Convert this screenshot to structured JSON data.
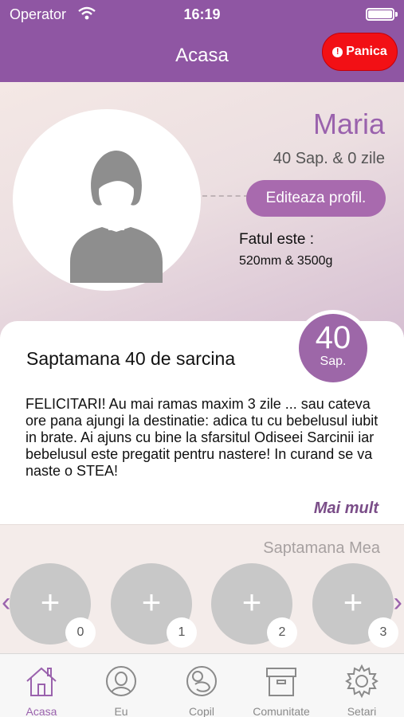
{
  "status_bar": {
    "carrier": "Operator",
    "time": "16:19"
  },
  "nav": {
    "title": "Acasa",
    "panic_label": "Panica",
    "panic_icon": "!"
  },
  "profile": {
    "name": "Maria",
    "weeks_text": "40 Sap. & 0 zile",
    "edit_label": "Editeaza profil.",
    "fetus_label": "Fatul este  :",
    "fetus_value": "520mm & 3500g"
  },
  "card": {
    "title": "Saptamana 40 de sarcina",
    "badge_number": "40",
    "badge_unit": "Sap.",
    "text": "FELICITARI! Au mai ramas maxim 3 zile ... sau cateva ore pana ajungi la destinatie: adica tu cu bebelusul iubit in brate. Ai ajuns cu bine la sfarsitul Odiseei Sarcinii iar bebelusul este pregatit pentru nastere! In curand se va naste o STEA!",
    "more_label": "Mai mult"
  },
  "my_week": {
    "title": "Saptamana Mea",
    "slots": [
      {
        "plus": "+",
        "number": "0"
      },
      {
        "plus": "+",
        "number": "1"
      },
      {
        "plus": "+",
        "number": "2"
      },
      {
        "plus": "+",
        "number": "3"
      }
    ],
    "prev_arrow": "‹",
    "next_arrow": "›"
  },
  "tabs": [
    {
      "label": "Acasa",
      "icon": "home-icon"
    },
    {
      "label": "Eu",
      "icon": "user-icon"
    },
    {
      "label": "Copil",
      "icon": "baby-icon"
    },
    {
      "label": "Comunitate",
      "icon": "box-icon"
    },
    {
      "label": "Setari",
      "icon": "gear-icon"
    }
  ],
  "colors": {
    "accent": "#8f56a3",
    "panic": "#f21015",
    "badge": "#9d67a8"
  }
}
